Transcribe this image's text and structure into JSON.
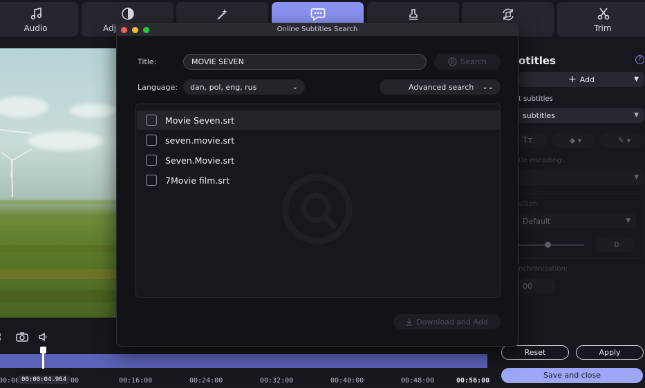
{
  "toolbar": {
    "tabs": [
      {
        "label": "Audio",
        "icon": "music-note-icon"
      },
      {
        "label": "Adj",
        "icon": "contrast-icon"
      },
      {
        "label": "",
        "icon": "magic-wand-icon"
      },
      {
        "label": "",
        "icon": "speech-bubble-icon"
      },
      {
        "label": "",
        "icon": "stamp-icon"
      },
      {
        "label": "",
        "icon": "rotate-icon"
      },
      {
        "label": "Trim",
        "icon": "scissors-icon"
      }
    ],
    "active_index": 3
  },
  "player": {
    "current_time": "00:00:04.964",
    "left_tick_prefix": "00:00:",
    "ticks": [
      "00",
      "00:16:00",
      "00:24:00",
      "00:32:00",
      "00:40:00",
      "00:48:00",
      "00:56:00"
    ]
  },
  "right_panel": {
    "title": "otitles",
    "add_label": "Add",
    "section_label": "t subtitles",
    "select_value": "subtitles",
    "encoding_label": "tle encoding:",
    "position_label": "sition:",
    "position_value": "Default",
    "stepper_value": "0",
    "sync_label": "nchronization:",
    "sync_value": "00",
    "reset_label": "Reset",
    "apply_label": "Apply",
    "save_close_label": "Save and close"
  },
  "dialog": {
    "window_title": "Online Subtitles Search",
    "title_label": "Title:",
    "title_value": "MOVIE SEVEN",
    "search_label": "Search",
    "language_label": "Language:",
    "language_value": "dan, pol, eng, rus",
    "advanced_label": "Advanced search",
    "results": [
      {
        "name": "Movie Seven.srt",
        "checked": false
      },
      {
        "name": "seven.movie.srt",
        "checked": false
      },
      {
        "name": "Seven.Movie.srt",
        "checked": false
      },
      {
        "name": "7Movie film.srt",
        "checked": false
      }
    ],
    "download_label": "Download and Add"
  },
  "colors": {
    "accent": "#8b93f2",
    "save_button": "#9ea6f7",
    "timeline": "#5a63b8"
  }
}
